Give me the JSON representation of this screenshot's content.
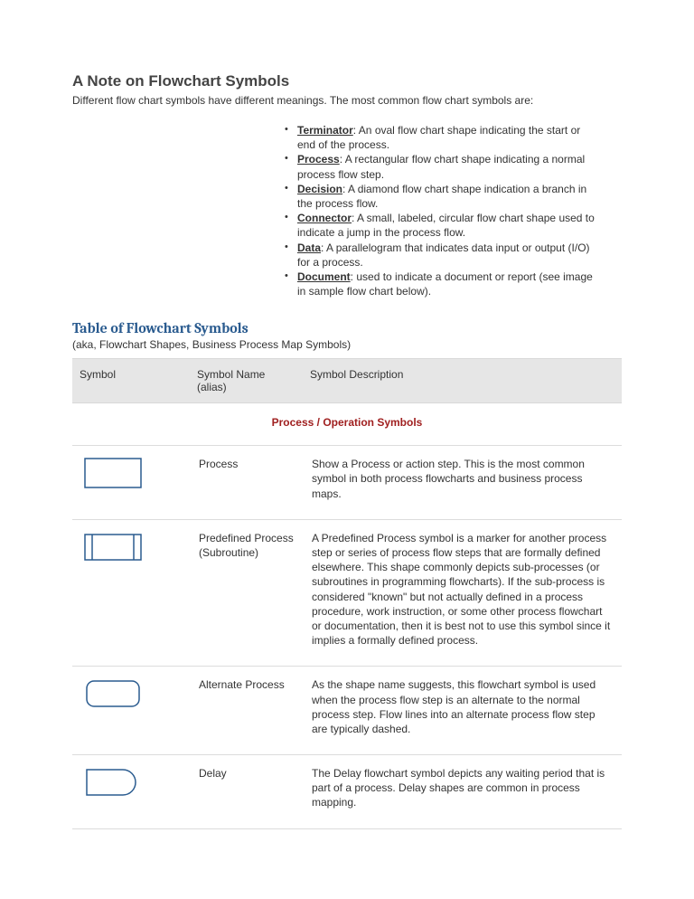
{
  "heading": "A Note on Flowchart Symbols",
  "intro": "Different flow chart symbols have different meanings. The most common flow chart symbols are:",
  "defs": [
    {
      "term": "Terminator",
      "desc": ": An oval flow chart shape indicating the start or end of the process."
    },
    {
      "term": "Process",
      "desc": ": A rectangular flow chart shape indicating a normal process flow step."
    },
    {
      "term": "Decision",
      "desc": ": A diamond flow chart shape indication a branch in the process flow."
    },
    {
      "term": "Connector",
      "desc": ": A small, labeled, circular flow chart shape used to indicate a jump in the process flow."
    },
    {
      "term": "Data",
      "desc": ": A parallelogram that indicates data input or output (I/O) for a process."
    },
    {
      "term": "Document",
      "desc": ": used to indicate a document or report (see image in sample flow chart below)."
    }
  ],
  "tableHeading": "Table of Flowchart Symbols",
  "aka": "(aka, Flowchart Shapes, Business Process Map Symbols)",
  "columns": {
    "c1": "Symbol",
    "c2": "Symbol Name (alias)",
    "c3": "Symbol Description"
  },
  "sectionTitle": "Process / Operation Symbols",
  "rows": [
    {
      "name": "Process",
      "desc": "Show a Process or action step. This is the most common symbol in both process flowcharts and business process maps."
    },
    {
      "name": "Predefined Process (Subroutine)",
      "desc": "A Predefined Process symbol is a marker for another process step or series of process flow steps that are formally defined elsewhere. This shape commonly depicts sub-processes (or subroutines in programming flowcharts). If the sub-process is considered \"known\" but not actually defined in a process procedure, work instruction, or some other process flowchart or documentation, then it is best not to use this symbol since it implies a formally defined process."
    },
    {
      "name": "Alternate Process",
      "desc": "As the shape name suggests, this flowchart symbol is used when the process flow step is an alternate to the normal process step. Flow lines into an alternate process flow step are typically dashed."
    },
    {
      "name": "Delay",
      "desc": "The Delay flowchart symbol depicts any waiting period that is part of a process. Delay shapes are common in process mapping."
    }
  ]
}
